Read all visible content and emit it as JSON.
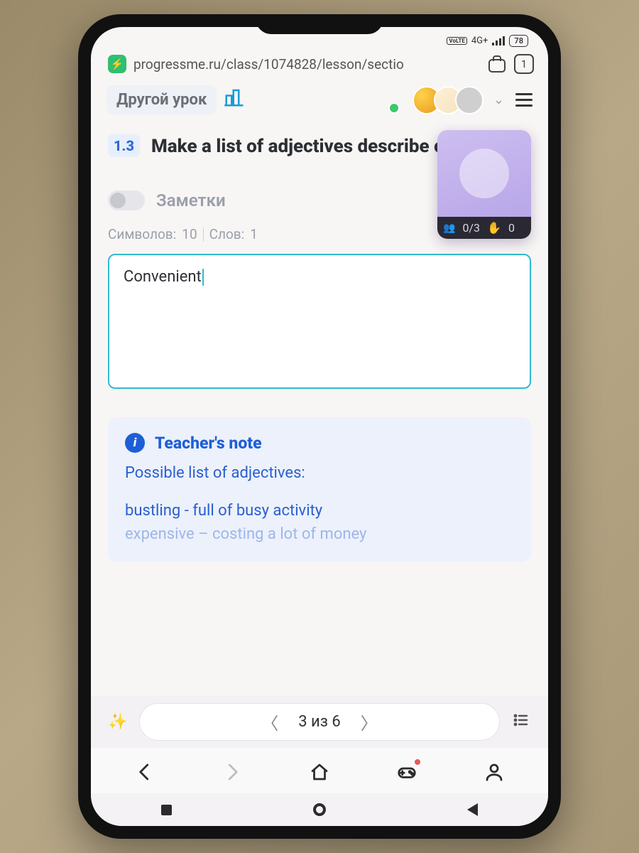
{
  "status": {
    "network": "4G+",
    "lte": "VoLTE",
    "battery": "78"
  },
  "browser": {
    "url": "progressme.ru/class/1074828/lesson/sectio",
    "tab_count": "1"
  },
  "header": {
    "other_lesson": "Другой урок"
  },
  "video": {
    "participants": "0/3",
    "raised": "0"
  },
  "task": {
    "number": "1.3",
    "title": "Make a list of adjectives describe city areas:"
  },
  "notes": {
    "label": "Заметки",
    "chars_label": "Символов:",
    "chars_value": "10",
    "words_label": "Слов:",
    "words_value": "1",
    "text": "Convenient"
  },
  "teacher_note": {
    "title": "Teacher's note",
    "subtitle": "Possible list of adjectives:",
    "line1": "bustling - full of busy activity",
    "line2": "expensive – costing a lot of money"
  },
  "pager": {
    "text": "3 из 6"
  }
}
